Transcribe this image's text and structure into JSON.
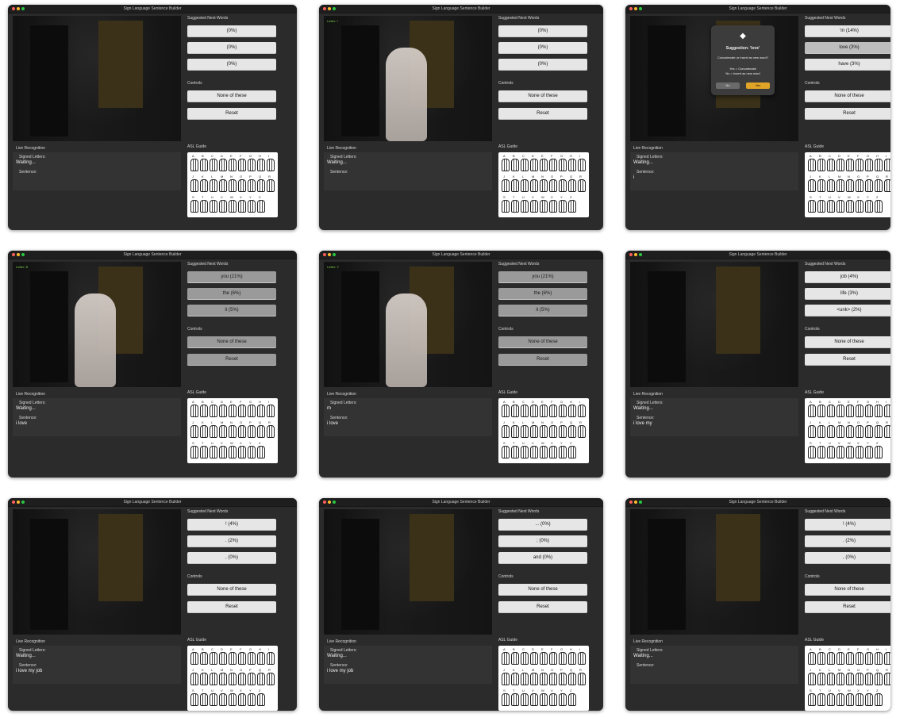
{
  "app": {
    "title": "Sign Language Sentence Builder",
    "headers": {
      "suggested": "Suggested Next Words",
      "controls": "Controls",
      "guide": "ASL Guide",
      "live": "Live Recognition",
      "signed": "Signed Letters:",
      "sentence": "Sentence:"
    },
    "controls": {
      "none": "None of these",
      "reset": "Reset"
    },
    "icons": {
      "bulb": "lightbulb-icon",
      "gear": "gear-icon",
      "book": "book-icon",
      "cross": "cross-icon",
      "reset": "reset-icon"
    }
  },
  "dialog": {
    "suggestion": "Suggestion: 'love'",
    "question": "Concatenate or insert as new word?",
    "hint_yes": "Yes = Concatenate",
    "hint_no": "No = Insert as new word",
    "no": "No",
    "yes": "Yes"
  },
  "guide_letters": [
    "A",
    "B",
    "C",
    "D",
    "E",
    "F",
    "G",
    "H",
    "I",
    "J",
    "K",
    "L",
    "M",
    "N",
    "O",
    "P",
    "Q",
    "R",
    "S",
    "T",
    "U",
    "V",
    "W",
    "X",
    "Y",
    "Z"
  ],
  "panels": [
    {
      "cam_overlay": "",
      "signed": "Waiting...",
      "sentence": "",
      "s": [
        "(0%)",
        "(0%)",
        "(0%)"
      ],
      "hand": false,
      "dialog": false
    },
    {
      "cam_overlay": "Letter: I",
      "signed": "Waiting...",
      "sentence": "",
      "s": [
        "(0%)",
        "(0%)",
        "(0%)"
      ],
      "hand": true,
      "dialog": false
    },
    {
      "cam_overlay": "",
      "signed": "Waiting...",
      "sentence": "i",
      "s": [
        "'m (14%)",
        "love (3%)",
        "have (3%)"
      ],
      "hand": false,
      "dialog": true
    },
    {
      "cam_overlay": "Letter: B",
      "signed": "Waiting...",
      "sentence": "i love",
      "s": [
        "you (21%)",
        "the (6%)",
        "it (5%)"
      ],
      "hand": true,
      "dialog": false
    },
    {
      "cam_overlay": "Letter: Y",
      "signed": "m",
      "sentence": "i love",
      "s": [
        "you (21%)",
        "the (6%)",
        "it (5%)"
      ],
      "hand": true,
      "dialog": false
    },
    {
      "cam_overlay": "",
      "signed": "Waiting...",
      "sentence": "i love my",
      "s": [
        "job (4%)",
        "life (3%)",
        "<unk> (2%)"
      ],
      "hand": false,
      "dialog": false
    },
    {
      "cam_overlay": "",
      "signed": "Waiting...",
      "sentence": "i love my job",
      "s": [
        "! (4%)",
        ". (2%)",
        ", (0%)"
      ],
      "hand": false,
      "dialog": false
    },
    {
      "cam_overlay": "",
      "signed": "Waiting...",
      "sentence": "i love my job",
      "s": [
        "... (0%)",
        "; (0%)",
        "and (0%)"
      ],
      "hand": false,
      "dialog": false
    },
    {
      "cam_overlay": "",
      "signed": "Waiting...",
      "sentence": "",
      "s": [
        "! (4%)",
        ". (2%)",
        ", (0%)"
      ],
      "hand": false,
      "dialog": false
    }
  ]
}
